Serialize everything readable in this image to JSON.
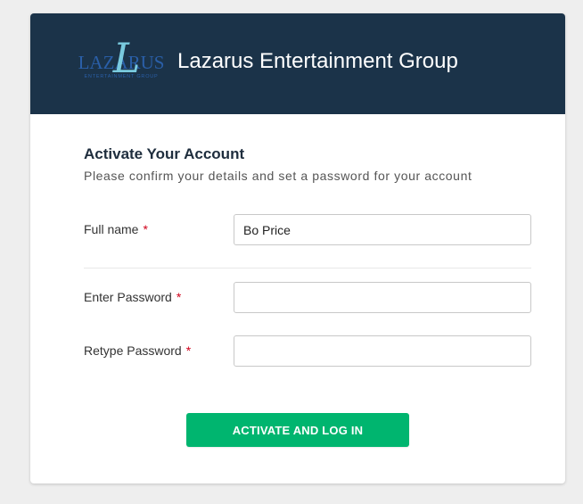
{
  "header": {
    "logo_main": "LAZARUS",
    "logo_sub": "ENTERTAINMENT GROUP",
    "logo_script_letter": "L",
    "brand_title": "Lazarus Entertainment Group",
    "background_color": "#1b3349"
  },
  "form": {
    "title": "Activate Your Account",
    "subtitle": "Please confirm your details and set a password for your account",
    "required_marker": "*",
    "fields": [
      {
        "label": "Full name",
        "value": "Bo Price",
        "placeholder": ""
      },
      {
        "label": "Enter Password",
        "value": "",
        "placeholder": ""
      },
      {
        "label": "Retype Password",
        "value": "",
        "placeholder": ""
      }
    ],
    "submit_label": "ACTIVATE AND LOG IN",
    "submit_color": "#00b56f"
  }
}
